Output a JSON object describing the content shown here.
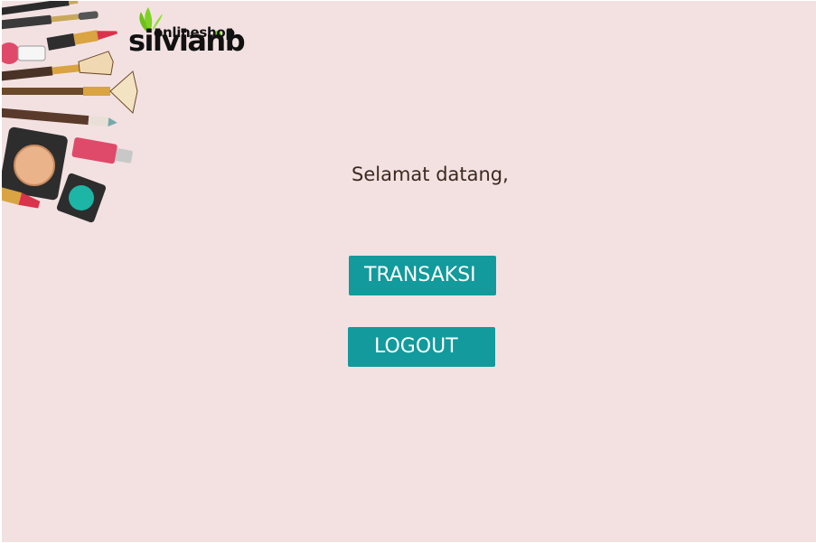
{
  "logo": {
    "main": "silvianb",
    "sub": "onlineshop"
  },
  "greeting": "Selamat datang,",
  "buttons": {
    "transaksi": "TRANSAKSI",
    "logout": "LOGOUT"
  },
  "colors": {
    "background": "#f3e1e2",
    "button": "#129a9c",
    "button_text": "#ffffff",
    "greeting_text": "#3a2a1e",
    "logo_leaf": "#7ed321"
  },
  "icons": {
    "decoration": "makeup-illustration",
    "logo": "leaf-icon"
  }
}
